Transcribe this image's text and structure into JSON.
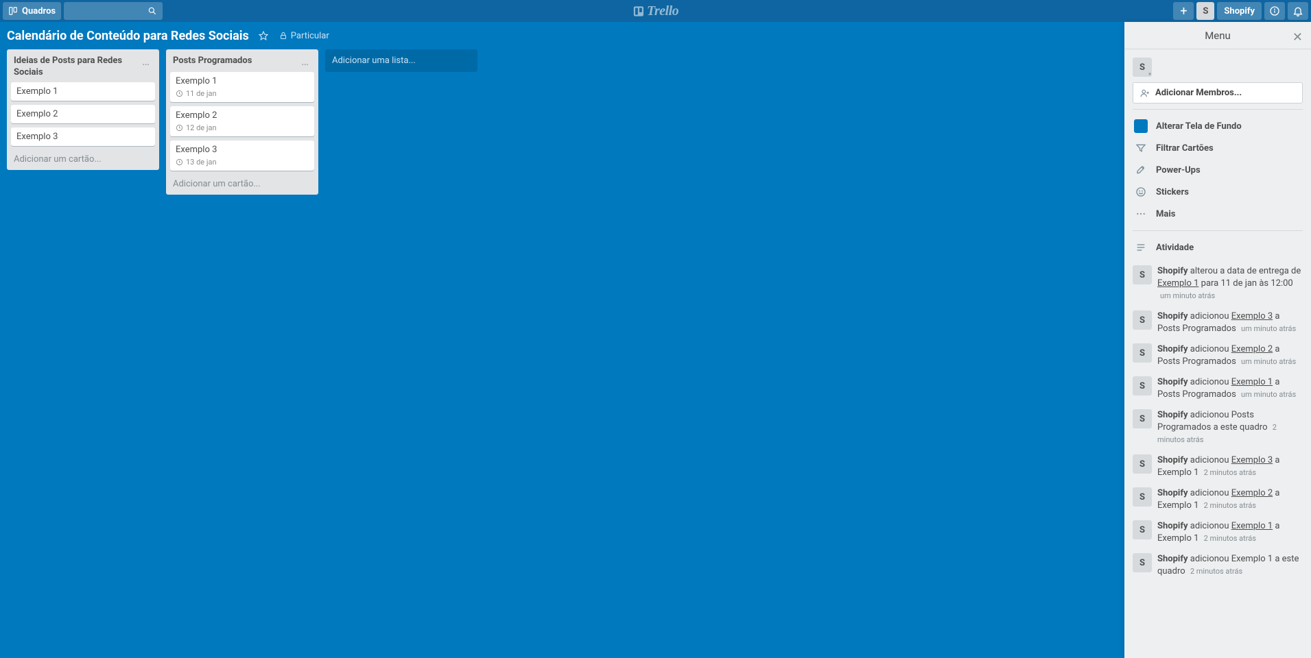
{
  "header": {
    "boards_label": "Quadros",
    "plus_icon": "+",
    "avatar_initial": "S",
    "member_name": "Shopify"
  },
  "board": {
    "title": "Calendário de Conteúdo para Redes Sociais",
    "privacy": "Particular"
  },
  "lists": [
    {
      "title": "Ideias de Posts para Redes Sociais",
      "cards": [
        {
          "text": "Exemplo 1",
          "badge": ""
        },
        {
          "text": "Exemplo 2",
          "badge": ""
        },
        {
          "text": "Exemplo 3",
          "badge": ""
        }
      ],
      "add": "Adicionar um cartão..."
    },
    {
      "title": "Posts Programados",
      "cards": [
        {
          "text": "Exemplo 1",
          "badge": "11 de jan"
        },
        {
          "text": "Exemplo 2",
          "badge": "12 de jan"
        },
        {
          "text": "Exemplo 3",
          "badge": "13 de jan"
        }
      ],
      "add": "Adicionar um cartão..."
    }
  ],
  "add_list": "Adicionar uma lista...",
  "menu": {
    "title": "Menu",
    "member_initial": "S",
    "add_members": "Adicionar Membros...",
    "items": {
      "bg": "Alterar Tela de Fundo",
      "filter": "Filtrar Cartões",
      "powerups": "Power-Ups",
      "stickers": "Stickers",
      "more": "Mais"
    },
    "activity_label": "Atividade",
    "activity": [
      {
        "user": "Shopify",
        "pre": " alterou a data de entrega de ",
        "link": "Exemplo 1",
        "post": " para 11 de jan às 12:00",
        "time": "um minuto atrás",
        "time_newline": true
      },
      {
        "user": "Shopify",
        "pre": " adicionou ",
        "link": "Exemplo 3",
        "post": " a Posts Programados",
        "time": "um minuto atrás"
      },
      {
        "user": "Shopify",
        "pre": " adicionou ",
        "link": "Exemplo 2",
        "post": " a Posts Programados",
        "time": "um minuto atrás"
      },
      {
        "user": "Shopify",
        "pre": " adicionou ",
        "link": "Exemplo 1",
        "post": " a Posts Programados",
        "time": "um minuto atrás"
      },
      {
        "user": "Shopify",
        "pre": " adicionou Posts Programados a este quadro",
        "link": "",
        "post": "",
        "time": "2 minutos atrás"
      },
      {
        "user": "Shopify",
        "pre": " adicionou ",
        "link": "Exemplo 3",
        "post": " a Exemplo 1",
        "time": "2 minutos atrás"
      },
      {
        "user": "Shopify",
        "pre": " adicionou ",
        "link": "Exemplo 2",
        "post": " a Exemplo 1",
        "time": "2 minutos atrás"
      },
      {
        "user": "Shopify",
        "pre": " adicionou ",
        "link": "Exemplo 1",
        "post": " a Exemplo 1",
        "time": "2 minutos atrás"
      },
      {
        "user": "Shopify",
        "pre": " adicionou Exemplo 1 a este quadro",
        "link": "",
        "post": "",
        "time": "2 minutos atrás"
      }
    ]
  }
}
